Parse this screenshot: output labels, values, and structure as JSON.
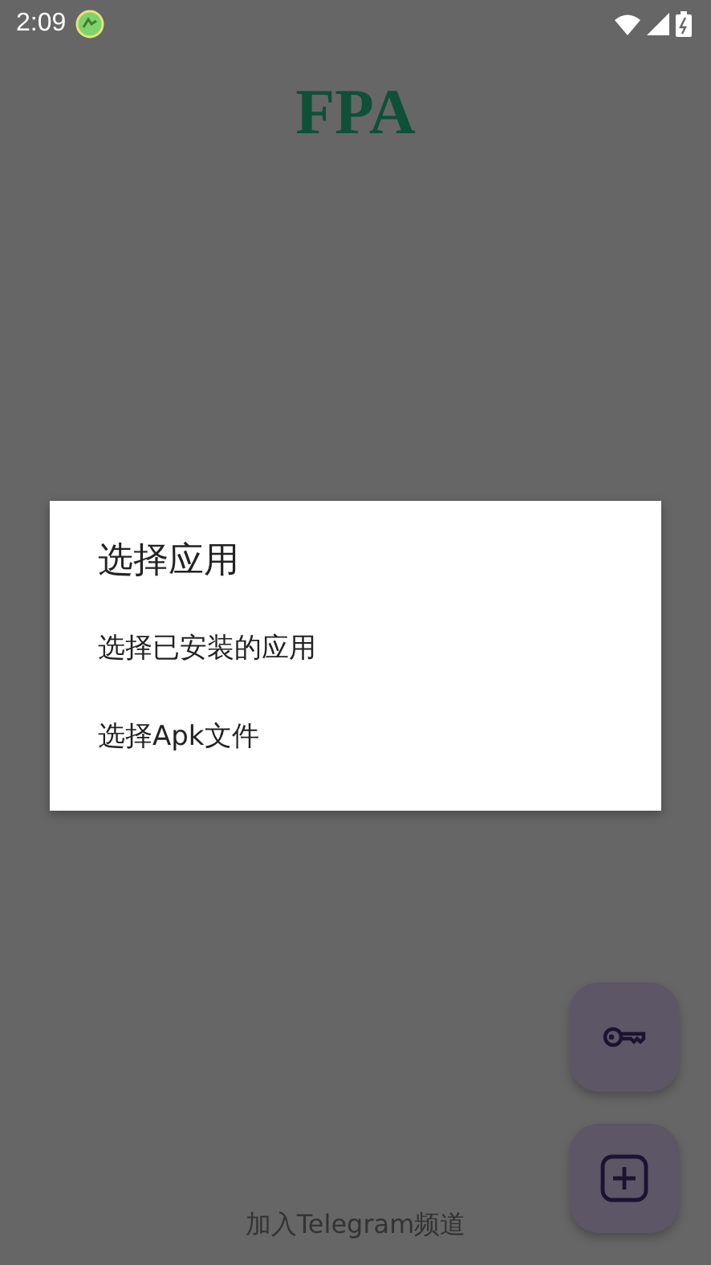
{
  "status_bar": {
    "time": "2:09"
  },
  "app": {
    "title": "FPA"
  },
  "dialog": {
    "title": "选择应用",
    "options": [
      {
        "label": "选择已安装的应用"
      },
      {
        "label": "选择Apk文件"
      }
    ]
  },
  "fabs": [
    {
      "kind": "key"
    },
    {
      "kind": "add"
    }
  ],
  "footer_link": "加入Telegram频道"
}
